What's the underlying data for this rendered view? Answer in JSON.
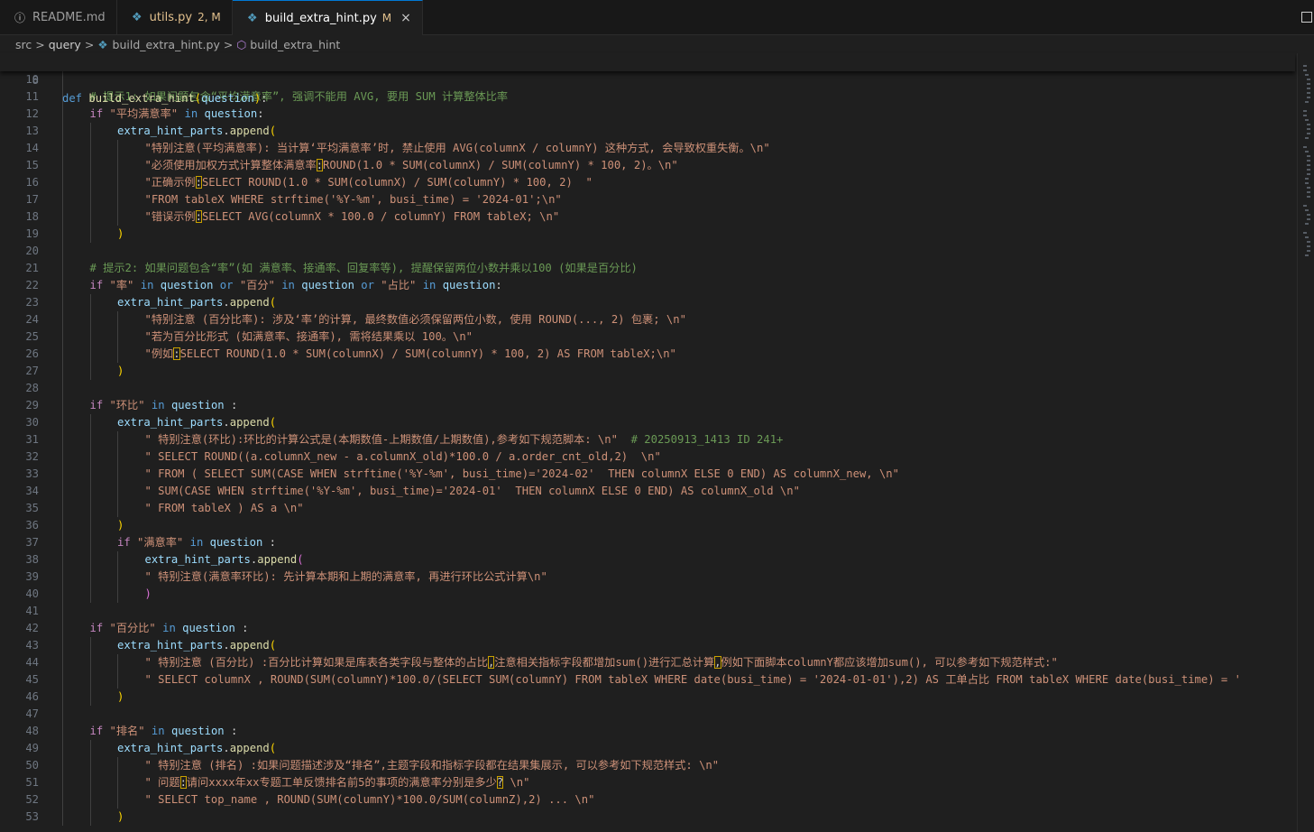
{
  "tabs": [
    {
      "name": "README.md",
      "icon": "info-icon",
      "status": "",
      "active": false,
      "modified": false
    },
    {
      "name": "utils.py",
      "icon": "python-icon",
      "status": "2, M",
      "active": false,
      "modified": true
    },
    {
      "name": "build_extra_hint.py",
      "icon": "python-icon",
      "status": "M",
      "active": true,
      "modified": false,
      "close": "×"
    }
  ],
  "breadcrumb": {
    "items": [
      "src",
      "query",
      "build_extra_hint.py",
      "build_extra_hint"
    ],
    "separator": ">"
  },
  "sticky_line": {
    "number": "8",
    "keyword": "def",
    "function": "build_extra_hint",
    "param": "question"
  },
  "colors": {
    "background": "#1f1f1f",
    "keyword": "#569cd6",
    "control": "#c586c0",
    "function": "#dcdcaa",
    "variable": "#9cdcfe",
    "string": "#ce9178",
    "comment": "#6a9955",
    "bracket_gold": "#ffd700",
    "highlight_border": "#c9a100"
  },
  "code_lines": [
    {
      "n": "10",
      "indent": 1,
      "tokens": []
    },
    {
      "n": "11",
      "indent": 1,
      "tokens": [
        [
          "cm",
          "# 提示1: 如果问题包含“平均满意率”, 强调不能用 AVG, 要用 SUM 计算整体比率"
        ]
      ]
    },
    {
      "n": "12",
      "indent": 1,
      "tokens": [
        [
          "kw2",
          "if "
        ],
        [
          "str",
          "\"平均满意率\""
        ],
        [
          "kw",
          " in "
        ],
        [
          "var",
          "question"
        ],
        [
          "pl",
          ":"
        ]
      ]
    },
    {
      "n": "13",
      "indent": 2,
      "tokens": [
        [
          "var",
          "extra_hint_parts"
        ],
        [
          "pl",
          "."
        ],
        [
          "fn",
          "append"
        ],
        [
          "p1",
          "("
        ]
      ]
    },
    {
      "n": "14",
      "indent": 3,
      "tokens": [
        [
          "str",
          "\"特别注意(平均满意率): 当计算‘平均满意率’时, 禁止使用 AVG(columnX / columnY) 这种方式, 会导致权重失衡。\\n\""
        ]
      ]
    },
    {
      "n": "15",
      "indent": 3,
      "tokens": [
        [
          "str",
          "\"必须使用加权方式计算整体满意率"
        ],
        [
          "hl",
          ":"
        ],
        [
          "str",
          "ROUND(1.0 * SUM(columnX) / SUM(columnY) * 100, 2)。\\n\""
        ]
      ]
    },
    {
      "n": "16",
      "indent": 3,
      "tokens": [
        [
          "str",
          "\"正确示例"
        ],
        [
          "hl",
          ":"
        ],
        [
          "str",
          "SELECT ROUND(1.0 * SUM(columnX) / SUM(columnY) * 100, 2)  \""
        ]
      ]
    },
    {
      "n": "17",
      "indent": 3,
      "tokens": [
        [
          "str",
          "\"FROM tableX WHERE strftime('%Y-%m', busi_time) = '2024-01';\\n\""
        ]
      ]
    },
    {
      "n": "18",
      "indent": 3,
      "tokens": [
        [
          "str",
          "\"错误示例"
        ],
        [
          "hl",
          ":"
        ],
        [
          "str",
          "SELECT AVG(columnX * 100.0 / columnY) FROM tableX; \\n\""
        ]
      ]
    },
    {
      "n": "19",
      "indent": 2,
      "tokens": [
        [
          "p1",
          ")"
        ]
      ]
    },
    {
      "n": "20",
      "indent": 1,
      "tokens": []
    },
    {
      "n": "21",
      "indent": 1,
      "tokens": [
        [
          "cm",
          "# 提示2: 如果问题包含“率”(如 满意率、接通率、回复率等), 提醒保留两位小数并乘以100 (如果是百分比)"
        ]
      ]
    },
    {
      "n": "22",
      "indent": 1,
      "tokens": [
        [
          "kw2",
          "if "
        ],
        [
          "str",
          "\"率\""
        ],
        [
          "kw",
          " in "
        ],
        [
          "var",
          "question"
        ],
        [
          "kw",
          " or "
        ],
        [
          "str",
          "\"百分\""
        ],
        [
          "kw",
          " in "
        ],
        [
          "var",
          "question"
        ],
        [
          "kw",
          " or "
        ],
        [
          "str",
          "\"占比\""
        ],
        [
          "kw",
          " in "
        ],
        [
          "var",
          "question"
        ],
        [
          "pl",
          ":"
        ]
      ]
    },
    {
      "n": "23",
      "indent": 2,
      "tokens": [
        [
          "var",
          "extra_hint_parts"
        ],
        [
          "pl",
          "."
        ],
        [
          "fn",
          "append"
        ],
        [
          "p1",
          "("
        ]
      ]
    },
    {
      "n": "24",
      "indent": 3,
      "tokens": [
        [
          "str",
          "\"特别注意 (百分比率): 涉及‘率’的计算, 最终数值必须保留两位小数, 使用 ROUND(..., 2) 包裹; \\n\""
        ]
      ]
    },
    {
      "n": "25",
      "indent": 3,
      "tokens": [
        [
          "str",
          "\"若为百分比形式 (如满意率、接通率), 需将结果乘以 100。\\n\""
        ]
      ]
    },
    {
      "n": "26",
      "indent": 3,
      "tokens": [
        [
          "str",
          "\"例如"
        ],
        [
          "hl",
          ":"
        ],
        [
          "str",
          "SELECT ROUND(1.0 * SUM(columnX) / SUM(columnY) * 100, 2) AS FROM tableX;\\n\""
        ]
      ]
    },
    {
      "n": "27",
      "indent": 2,
      "tokens": [
        [
          "p1",
          ")"
        ]
      ]
    },
    {
      "n": "28",
      "indent": 1,
      "tokens": []
    },
    {
      "n": "29",
      "indent": 1,
      "tokens": [
        [
          "kw2",
          "if "
        ],
        [
          "str",
          "\"环比\""
        ],
        [
          "kw",
          " in "
        ],
        [
          "var",
          "question"
        ],
        [
          "pl",
          " :"
        ]
      ]
    },
    {
      "n": "30",
      "indent": 2,
      "tokens": [
        [
          "var",
          "extra_hint_parts"
        ],
        [
          "pl",
          "."
        ],
        [
          "fn",
          "append"
        ],
        [
          "p1",
          "("
        ]
      ]
    },
    {
      "n": "31",
      "indent": 3,
      "tokens": [
        [
          "str",
          "\" 特别注意(环比):环比的计算公式是(本期数值-上期数值/上期数值),参考如下规范脚本: \\n\""
        ],
        [
          "pl",
          "  "
        ],
        [
          "cm",
          "# 20250913_1413 ID 241+"
        ]
      ]
    },
    {
      "n": "32",
      "indent": 3,
      "tokens": [
        [
          "str",
          "\" SELECT ROUND((a.columnX_new - a.columnX_old)*100.0 / a.order_cnt_old,2)  \\n\""
        ]
      ]
    },
    {
      "n": "33",
      "indent": 3,
      "tokens": [
        [
          "str",
          "\" FROM ( SELECT SUM(CASE WHEN strftime('%Y-%m', busi_time)='2024-02'  THEN columnX ELSE 0 END) AS columnX_new, \\n\""
        ]
      ]
    },
    {
      "n": "34",
      "indent": 3,
      "tokens": [
        [
          "str",
          "\" SUM(CASE WHEN strftime('%Y-%m', busi_time)='2024-01'  THEN columnX ELSE 0 END) AS columnX_old \\n\""
        ]
      ]
    },
    {
      "n": "35",
      "indent": 3,
      "tokens": [
        [
          "str",
          "\" FROM tableX ) AS a \\n\""
        ]
      ]
    },
    {
      "n": "36",
      "indent": 2,
      "tokens": [
        [
          "p1",
          ")"
        ]
      ]
    },
    {
      "n": "37",
      "indent": 2,
      "tokens": [
        [
          "kw2",
          "if "
        ],
        [
          "str",
          "\"满意率\""
        ],
        [
          "kw",
          " in "
        ],
        [
          "var",
          "question"
        ],
        [
          "pl",
          " :"
        ]
      ]
    },
    {
      "n": "38",
      "indent": 3,
      "tokens": [
        [
          "var",
          "extra_hint_parts"
        ],
        [
          "pl",
          "."
        ],
        [
          "fn",
          "append"
        ],
        [
          "p2",
          "("
        ]
      ]
    },
    {
      "n": "39",
      "indent": 3,
      "tokens": [
        [
          "str",
          "\" 特别注意(满意率环比): 先计算本期和上期的满意率, 再进行环比公式计算\\n\""
        ]
      ]
    },
    {
      "n": "40",
      "indent": 3,
      "tokens": [
        [
          "p2",
          ")"
        ]
      ]
    },
    {
      "n": "41",
      "indent": 1,
      "tokens": []
    },
    {
      "n": "42",
      "indent": 1,
      "tokens": [
        [
          "kw2",
          "if "
        ],
        [
          "str",
          "\"百分比\""
        ],
        [
          "kw",
          " in "
        ],
        [
          "var",
          "question"
        ],
        [
          "pl",
          " :"
        ]
      ]
    },
    {
      "n": "43",
      "indent": 2,
      "tokens": [
        [
          "var",
          "extra_hint_parts"
        ],
        [
          "pl",
          "."
        ],
        [
          "fn",
          "append"
        ],
        [
          "p1",
          "("
        ]
      ]
    },
    {
      "n": "44",
      "indent": 3,
      "tokens": [
        [
          "str",
          "\" 特别注意 (百分比) :百分比计算如果是库表各类字段与整体的占比"
        ],
        [
          "hl",
          ","
        ],
        [
          "str",
          "注意相关指标字段都增加sum()进行汇总计算"
        ],
        [
          "hl",
          ","
        ],
        [
          "str",
          "例如下面脚本columnY都应该增加sum(), 可以参考如下规范样式:\""
        ]
      ]
    },
    {
      "n": "45",
      "indent": 3,
      "tokens": [
        [
          "str",
          "\" SELECT columnX , ROUND(SUM(columnY)*100.0/(SELECT SUM(columnY) FROM tableX WHERE date(busi_time) = '2024-01-01'),2) AS 工单占比 FROM tableX WHERE date(busi_time) = '"
        ]
      ]
    },
    {
      "n": "46",
      "indent": 2,
      "tokens": [
        [
          "p1",
          ")"
        ]
      ]
    },
    {
      "n": "47",
      "indent": 1,
      "tokens": []
    },
    {
      "n": "48",
      "indent": 1,
      "tokens": [
        [
          "kw2",
          "if "
        ],
        [
          "str",
          "\"排名\""
        ],
        [
          "kw",
          " in "
        ],
        [
          "var",
          "question"
        ],
        [
          "pl",
          " :"
        ]
      ]
    },
    {
      "n": "49",
      "indent": 2,
      "tokens": [
        [
          "var",
          "extra_hint_parts"
        ],
        [
          "pl",
          "."
        ],
        [
          "fn",
          "append"
        ],
        [
          "p1",
          "("
        ]
      ]
    },
    {
      "n": "50",
      "indent": 3,
      "tokens": [
        [
          "str",
          "\" 特别注意 (排名) :如果问题描述涉及“排名”,主题字段和指标字段都在结果集展示, 可以参考如下规范样式: \\n\""
        ]
      ]
    },
    {
      "n": "51",
      "indent": 3,
      "tokens": [
        [
          "str",
          "\" 问题"
        ],
        [
          "hl",
          ":"
        ],
        [
          "str",
          "请问xxxx年xx专题工单反馈排名前5的事项的满意率分别是多少"
        ],
        [
          "hl",
          "?"
        ],
        [
          "str",
          " \\n\""
        ]
      ]
    },
    {
      "n": "52",
      "indent": 3,
      "tokens": [
        [
          "str",
          "\" SELECT top_name , ROUND(SUM(columnY)*100.0/SUM(columnZ),2) ... \\n\""
        ]
      ]
    },
    {
      "n": "53",
      "indent": 2,
      "tokens": [
        [
          "p1",
          ")"
        ]
      ]
    }
  ]
}
